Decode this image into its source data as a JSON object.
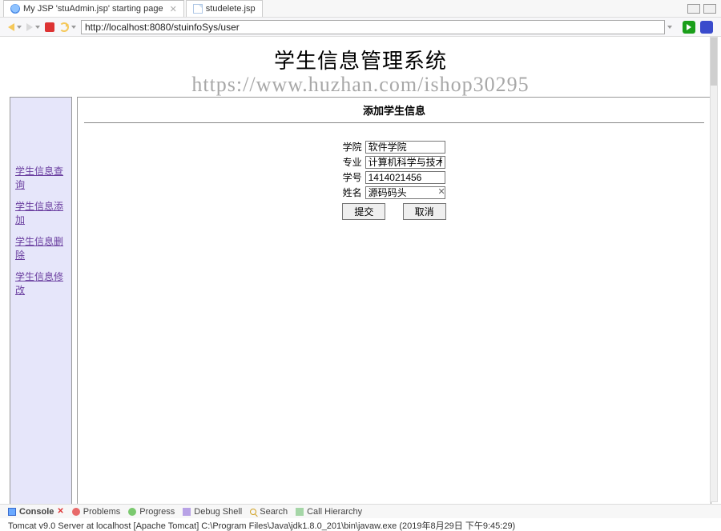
{
  "tabs": {
    "active": {
      "label": "My JSP 'stuAdmin.jsp' starting page"
    },
    "other": {
      "label": "studelete.jsp"
    }
  },
  "url": "http://localhost:8080/stuinfoSys/user",
  "page": {
    "title": "学生信息管理系统",
    "watermark": "https://www.huzhan.com/ishop30295",
    "sub_title": "添加学生信息"
  },
  "sidebar": {
    "items": [
      {
        "label": "学生信息查询"
      },
      {
        "label": "学生信息添加"
      },
      {
        "label": "学生信息删除"
      },
      {
        "label": "学生信息修改"
      }
    ]
  },
  "form": {
    "fields": {
      "college": {
        "label": "学院",
        "value": "软件学院"
      },
      "major": {
        "label": "专业",
        "value": "计算机科学与技术"
      },
      "sno": {
        "label": "学号",
        "value": "1414021456"
      },
      "name": {
        "label": "姓名",
        "value": "源码码头"
      }
    },
    "submit_label": "提交",
    "cancel_label": "取消"
  },
  "bottom_views": {
    "console": "Console",
    "problems": "Problems",
    "progress": "Progress",
    "debugshell": "Debug Shell",
    "search": "Search",
    "callh": "Call Hierarchy"
  },
  "status": "Tomcat v9.0 Server at localhost [Apache Tomcat] C:\\Program Files\\Java\\jdk1.8.0_201\\bin\\javaw.exe (2019年8月29日 下午9:45:29)"
}
